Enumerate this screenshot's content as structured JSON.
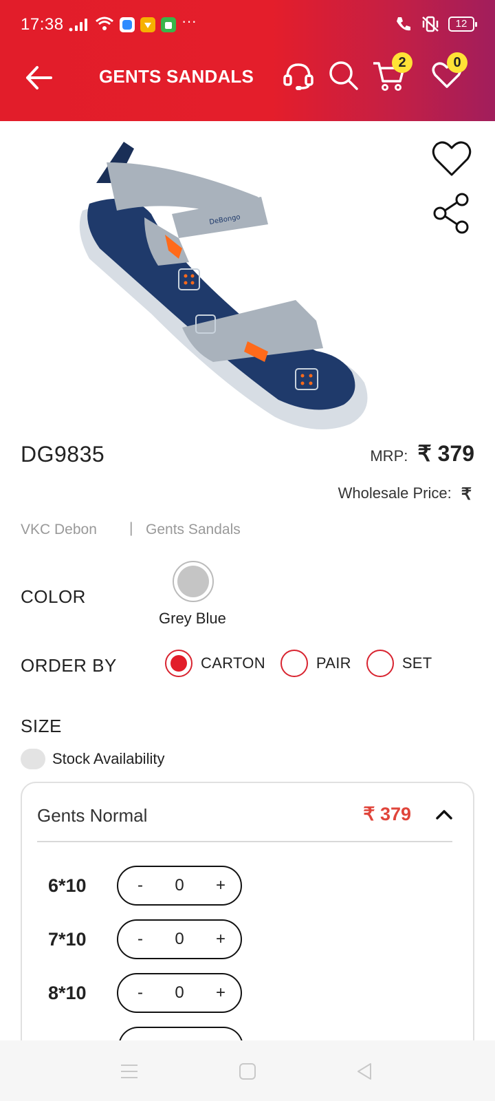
{
  "status_bar": {
    "time": "17:38",
    "battery": "12"
  },
  "header": {
    "title": "GENTS SANDALS",
    "cart_count": "2",
    "wishlist_count": "0"
  },
  "product": {
    "sku": "DG9835",
    "mrp_label": "MRP:",
    "mrp_value": "₹ 379",
    "wholesale_label": "Wholesale Price:",
    "wholesale_value": "₹",
    "brand": "VKC Debon",
    "separator": "|",
    "category": "Gents Sandals",
    "image_brand_text": "DeBongo"
  },
  "color": {
    "label": "COLOR",
    "selected_name": "Grey Blue",
    "swatch_hex": "#c5c5c5"
  },
  "order_by": {
    "label": "ORDER BY",
    "options": [
      "CARTON",
      "PAIR",
      "SET"
    ],
    "selected": "CARTON"
  },
  "size": {
    "label": "SIZE",
    "stock_label": "Stock Availability",
    "group_name": "Gents Normal",
    "group_price": "₹ 379",
    "rows": [
      {
        "size": "6*10",
        "minus": "-",
        "qty": "0",
        "plus": "+"
      },
      {
        "size": "7*10",
        "minus": "-",
        "qty": "0",
        "plus": "+"
      },
      {
        "size": "8*10",
        "minus": "-",
        "qty": "0",
        "plus": "+"
      }
    ]
  },
  "colors": {
    "primary_red": "#e21d2a",
    "gradient_end": "#a11e5c",
    "badge_yellow": "#ffe236",
    "price_red": "#e0453b"
  }
}
